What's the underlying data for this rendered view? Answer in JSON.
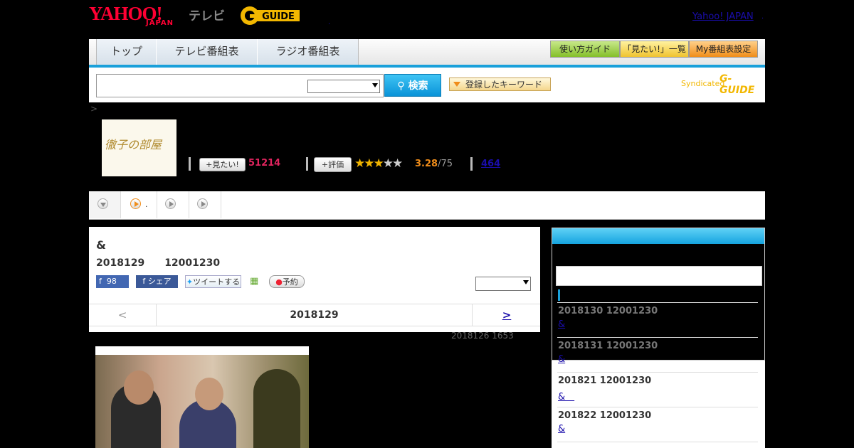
{
  "header": {
    "logo_yahoo": "YAHOO!",
    "logo_japan": "JAPAN",
    "logo_tv": "テレビ",
    "logo_gguide": "G-GUIDE",
    "yahoo_japan_link": "Yahoo! JAPAN"
  },
  "nav": {
    "tabs": [
      "トップ",
      "テレビ番組表",
      "ラジオ番組表"
    ],
    "guide_buttons": [
      "使い方ガイド",
      "「見たい!」一覧",
      "My番組表設定"
    ]
  },
  "search": {
    "button_label": "検索",
    "keyword_button": "登録したキーワード",
    "syndicated": "Syndicated",
    "syndicated_logo": "G-GUIDE"
  },
  "breadcrumb": ">",
  "program": {
    "thumb_title": "徹子の部屋",
    "mitai_label": "見たい!",
    "mitai_count": "51214",
    "hyoka_label": "評価",
    "rating_score": "3.28",
    "rating_max": "/75",
    "rating_stars": 3,
    "review_count": "464"
  },
  "tabs": {
    "tab2_suffix": "."
  },
  "episode": {
    "title": "&",
    "date_line": "2018129　　12001230",
    "fb_like_count": "98",
    "fb_share": "シェア",
    "tweet": "ツイートする",
    "reserve": "予約",
    "prev": "<",
    "current": "2018129",
    "next": ">",
    "updated": "2018126  1653"
  },
  "side": {
    "items": [
      {
        "date": "2018130  12001230",
        "link": "&",
        "dim": true
      },
      {
        "date": "2018131  12001230",
        "link": "&",
        "dim": true
      },
      {
        "date": "201821  12001230",
        "link": "&　",
        "dim": false
      },
      {
        "date": "201822  12001230",
        "link": "&",
        "dim": false
      }
    ]
  }
}
